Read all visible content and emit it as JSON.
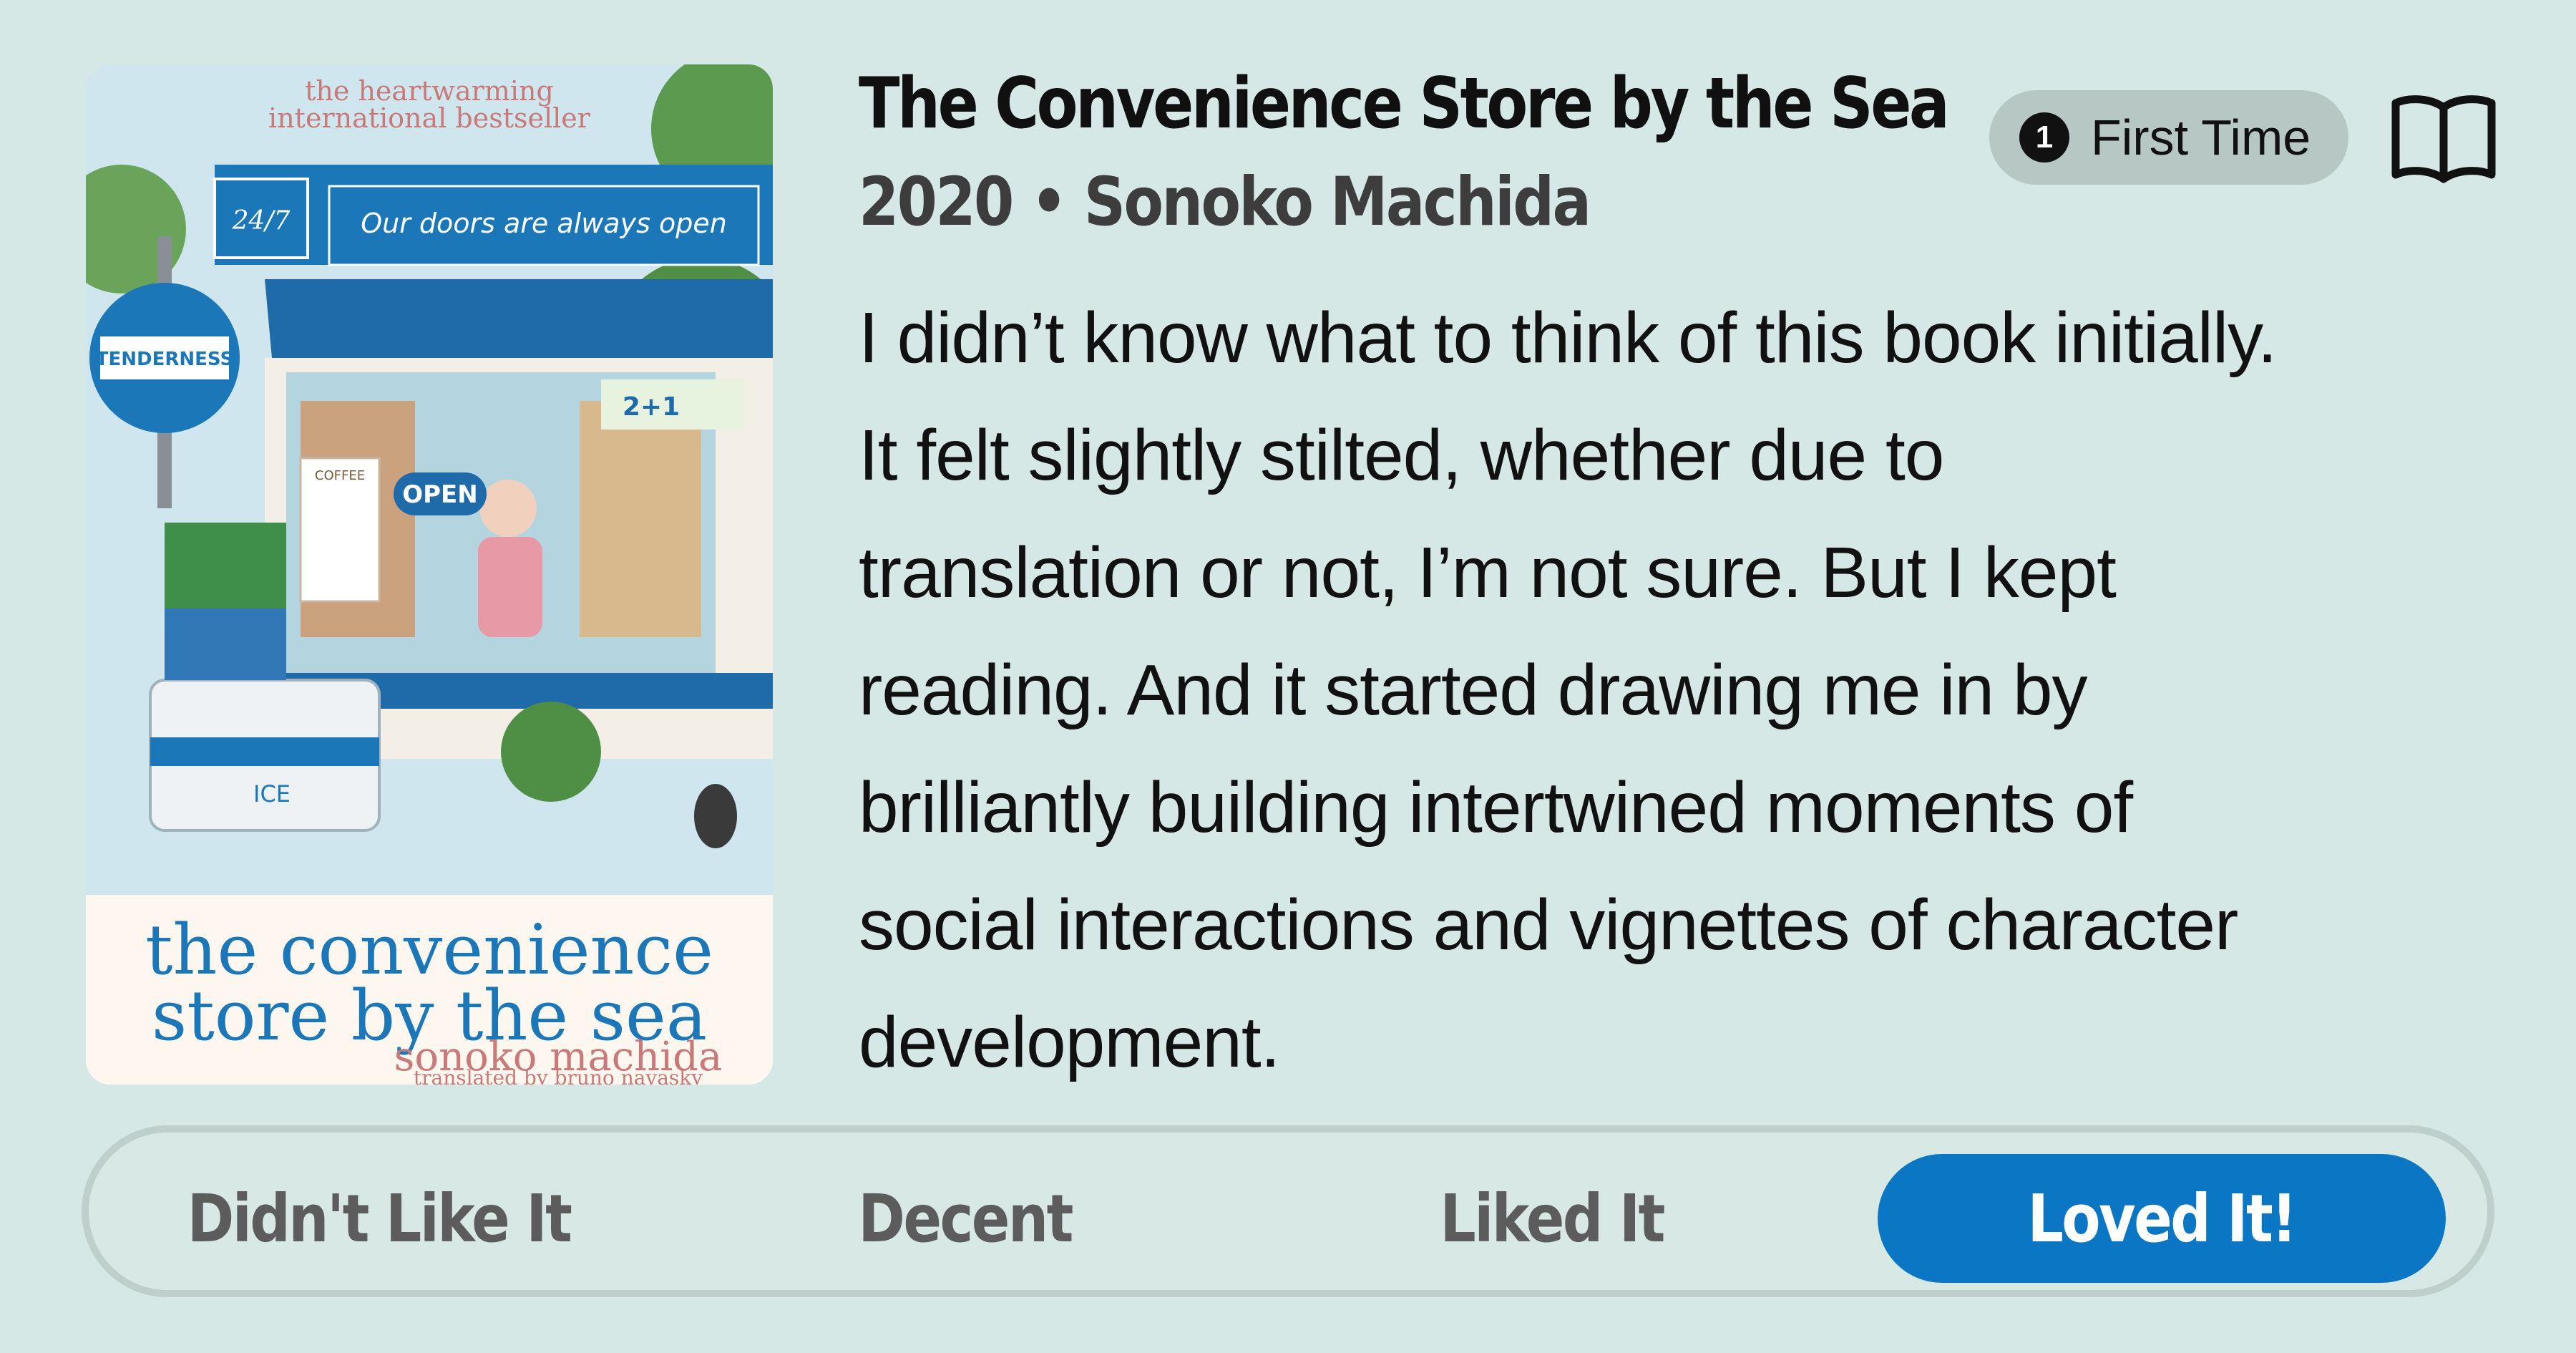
{
  "book": {
    "title": "The Convenience Store by the Sea",
    "meta": "2020 • Sonoko Machida",
    "badge_number": "1",
    "badge_label": "First Time",
    "book_icon": "book-open-icon"
  },
  "cover": {
    "tagline_1": "the heartwarming",
    "tagline_2": "international bestseller",
    "sign_24_7": "24/7",
    "sign_doors": "Our doors are always open",
    "sign_round": "TENDERNESS",
    "sign_open": "OPEN",
    "sign_coffee": "COFFEE",
    "sign_event": "2+1",
    "sign_ice": "ICE",
    "title_1": "the convenience",
    "title_2": "store by the sea",
    "author": "sonoko machida",
    "translator": "translated by bruno navasky"
  },
  "review": {
    "lines": [
      "I didn’t know what to think of this book initially.",
      "It felt slightly stilted, whether due to",
      "translation or not, I’m not sure. But I kept",
      "reading. And it started drawing me in by",
      "brilliantly building intertwined moments of",
      "social interactions and vignettes of character",
      "development."
    ]
  },
  "rating": {
    "options": [
      "Didn't Like It",
      "Decent",
      "Liked It",
      "Loved It!"
    ],
    "selected": "Loved It!",
    "accent_color": "#0a76c4"
  }
}
